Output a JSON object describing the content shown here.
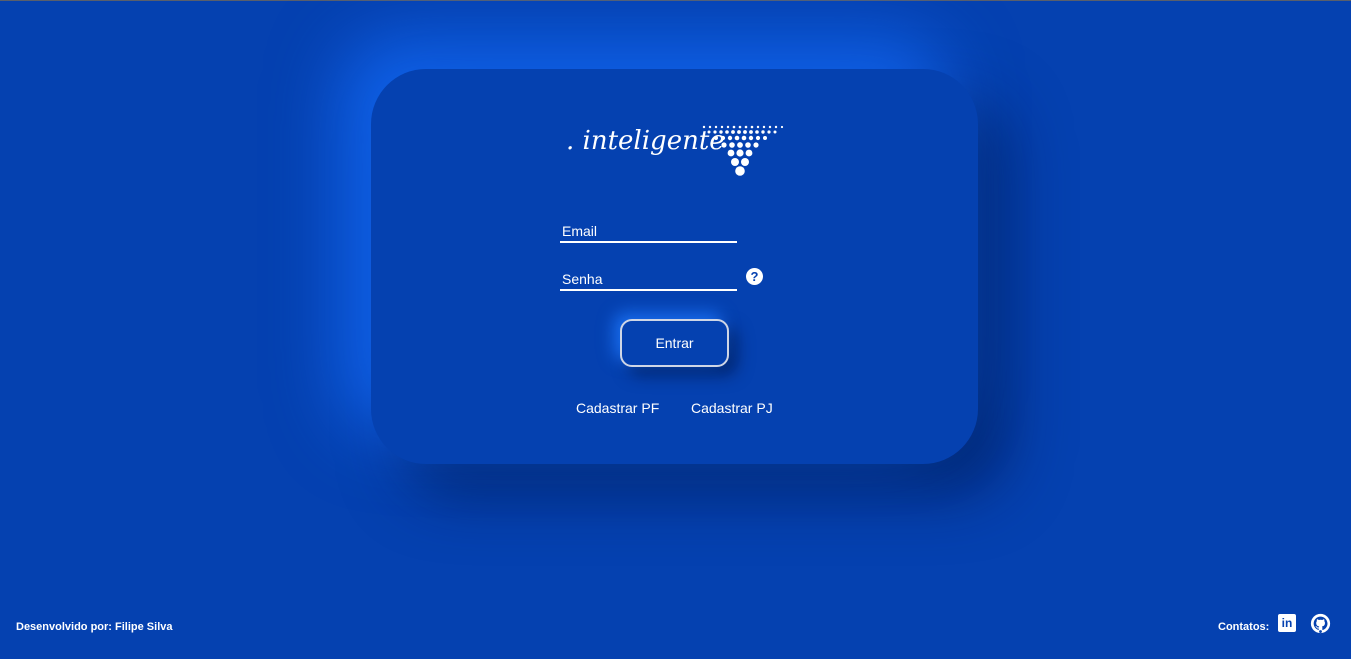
{
  "brand": {
    "logo_text": ". inteligente",
    "logo_mark_icon": "dotted-triangle-logo-icon"
  },
  "form": {
    "email_placeholder": "Email",
    "password_placeholder": "Senha",
    "help_icon": "question-icon",
    "help_glyph": "?",
    "submit_label": "Entrar"
  },
  "links": {
    "register_pf": "Cadastrar PF",
    "register_pj": "Cadastrar PJ"
  },
  "footer": {
    "credit": "Desenvolvido por: Filipe Silva",
    "contacts_label": "Contatos:",
    "linkedin_icon": "linkedin-icon",
    "linkedin_glyph": "in",
    "github_icon": "github-icon"
  },
  "colors": {
    "background": "#0541b0",
    "glow": "#146eff",
    "text": "#ffffff"
  }
}
